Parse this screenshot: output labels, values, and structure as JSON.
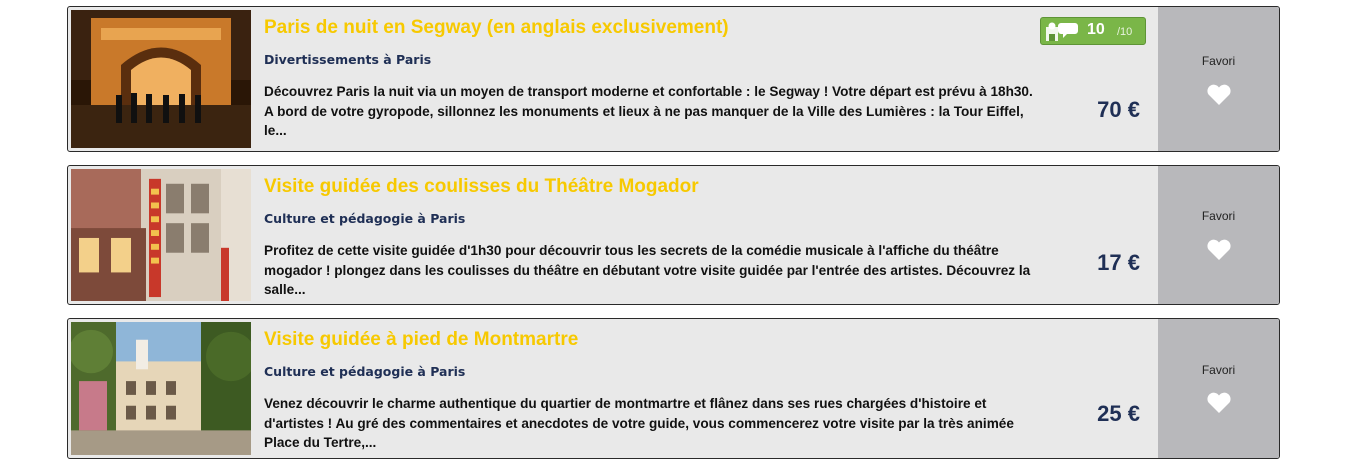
{
  "listings": [
    {
      "title": "Paris de nuit en Segway (en anglais exclusivement)",
      "category": "Divertissements à Paris",
      "description": "Découvrez Paris la nuit via un moyen de transport  moderne et confortable : le Segway ! Votre départ est prévu à 18h30. A bord de votre gyropode, sillonnez les monuments et lieux à ne pas manquer de la Ville des Lumières : la Tour Eiffel, le...",
      "price": "70 €",
      "favorite_label": "Favori",
      "rating": {
        "value": "10",
        "max": "/10",
        "icon": "users-rating-icon"
      }
    },
    {
      "title": "Visite guidée des coulisses du Théâtre Mogador",
      "category": "Culture et pédagogie à Paris",
      "description": "Profitez de cette visite guidée d'1h30 pour découvrir tous les secrets de la comédie musicale à l'affiche du théâtre mogador !   plongez dans les coulisses du théâtre en débutant votre visite guidée par l'entrée des artistes. Découvrez la salle...",
      "price": "17 €",
      "favorite_label": "Favori"
    },
    {
      "title": "Visite guidée à pied de Montmartre",
      "category": "Culture et pédagogie à Paris",
      "description": "Venez découvrir le charme authentique du quartier de montmartre et flânez dans ses rues chargées d'histoire et d'artistes ! Au gré des commentaires et anecdotes de votre guide, vous commencerez votre visite par la très animée Place du Tertre,...",
      "price": "25 €",
      "favorite_label": "Favori"
    }
  ],
  "colors": {
    "title": "#f7c900",
    "category": "#1f2f55",
    "card_bg": "#e9e9e9",
    "favorite_panel": "#b8b8bb",
    "rating_badge": "#7ab648"
  }
}
